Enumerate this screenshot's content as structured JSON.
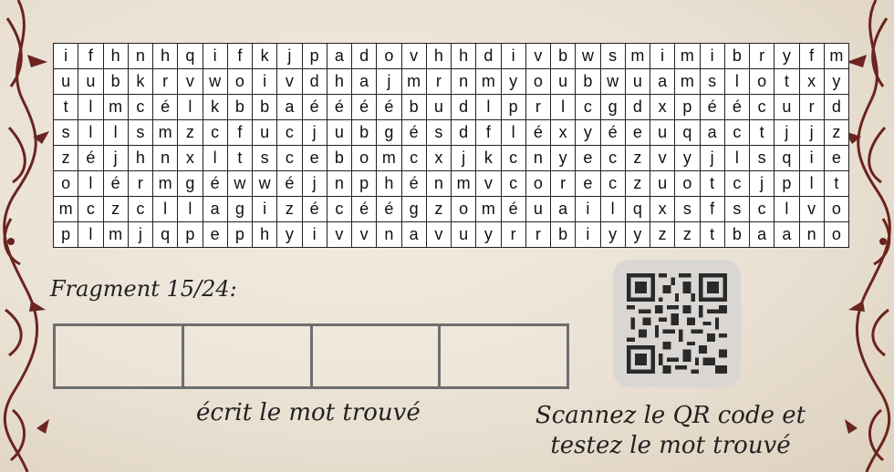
{
  "grid": [
    [
      "i",
      "f",
      "h",
      "n",
      "h",
      "q",
      "i",
      "f",
      "k",
      "j",
      "p",
      "a",
      "d",
      "o",
      "v",
      "h",
      "h",
      "d",
      "i",
      "v",
      "b",
      "w",
      "s",
      "m",
      "i",
      "m",
      "i",
      "b",
      "r",
      "y",
      "f",
      "m"
    ],
    [
      "u",
      "u",
      "b",
      "k",
      "r",
      "v",
      "w",
      "o",
      "i",
      "v",
      "d",
      "h",
      "a",
      "j",
      "m",
      "r",
      "n",
      "m",
      "y",
      "o",
      "u",
      "b",
      "w",
      "u",
      "a",
      "m",
      "s",
      "l",
      "o",
      "t",
      "x",
      "y"
    ],
    [
      "t",
      "l",
      "m",
      "c",
      "é",
      "l",
      "k",
      "b",
      "b",
      "a",
      "é",
      "é",
      "é",
      "é",
      "b",
      "u",
      "d",
      "l",
      "p",
      "r",
      "l",
      "c",
      "g",
      "d",
      "x",
      "p",
      "é",
      "é",
      "c",
      "u",
      "r",
      "d"
    ],
    [
      "s",
      "l",
      "l",
      "s",
      "m",
      "z",
      "c",
      "f",
      "u",
      "c",
      "j",
      "u",
      "b",
      "g",
      "é",
      "s",
      "d",
      "f",
      "l",
      "é",
      "x",
      "y",
      "é",
      "e",
      "u",
      "q",
      "a",
      "c",
      "t",
      "j",
      "j",
      "z"
    ],
    [
      "z",
      "é",
      "j",
      "h",
      "n",
      "x",
      "l",
      "t",
      "s",
      "c",
      "e",
      "b",
      "o",
      "m",
      "c",
      "x",
      "j",
      "k",
      "c",
      "n",
      "y",
      "e",
      "c",
      "z",
      "v",
      "y",
      "j",
      "l",
      "s",
      "q",
      "i",
      "e"
    ],
    [
      "o",
      "l",
      "é",
      "r",
      "m",
      "g",
      "é",
      "w",
      "w",
      "é",
      "j",
      "n",
      "p",
      "h",
      "é",
      "n",
      "m",
      "v",
      "c",
      "o",
      "r",
      "e",
      "c",
      "z",
      "u",
      "o",
      "t",
      "c",
      "j",
      "p",
      "l",
      "t"
    ],
    [
      "m",
      "c",
      "z",
      "c",
      "l",
      "l",
      "a",
      "g",
      "i",
      "z",
      "é",
      "c",
      "é",
      "é",
      "g",
      "z",
      "o",
      "m",
      "é",
      "u",
      "a",
      "i",
      "l",
      "q",
      "x",
      "s",
      "f",
      "s",
      "c",
      "l",
      "v",
      "o"
    ],
    [
      "p",
      "l",
      "m",
      "j",
      "q",
      "p",
      "e",
      "p",
      "h",
      "y",
      "i",
      "v",
      "v",
      "n",
      "a",
      "v",
      "u",
      "y",
      "r",
      "r",
      "b",
      "i",
      "y",
      "y",
      "z",
      "z",
      "t",
      "b",
      "a",
      "a",
      "n",
      "o"
    ]
  ],
  "fragment": {
    "label": "Fragment 15/24:"
  },
  "answer": {
    "box_count": 4,
    "caption": "écrit le mot trouvé"
  },
  "qr": {
    "icon": "qr-code-icon",
    "caption_line1": "Scannez le QR code et",
    "caption_line2": "testez le mot trouvé"
  },
  "colors": {
    "ornament": "#6b2420",
    "grid_border": "#222222",
    "box_border": "#6e6e6e",
    "qr_bg": "#d9d6d3"
  }
}
